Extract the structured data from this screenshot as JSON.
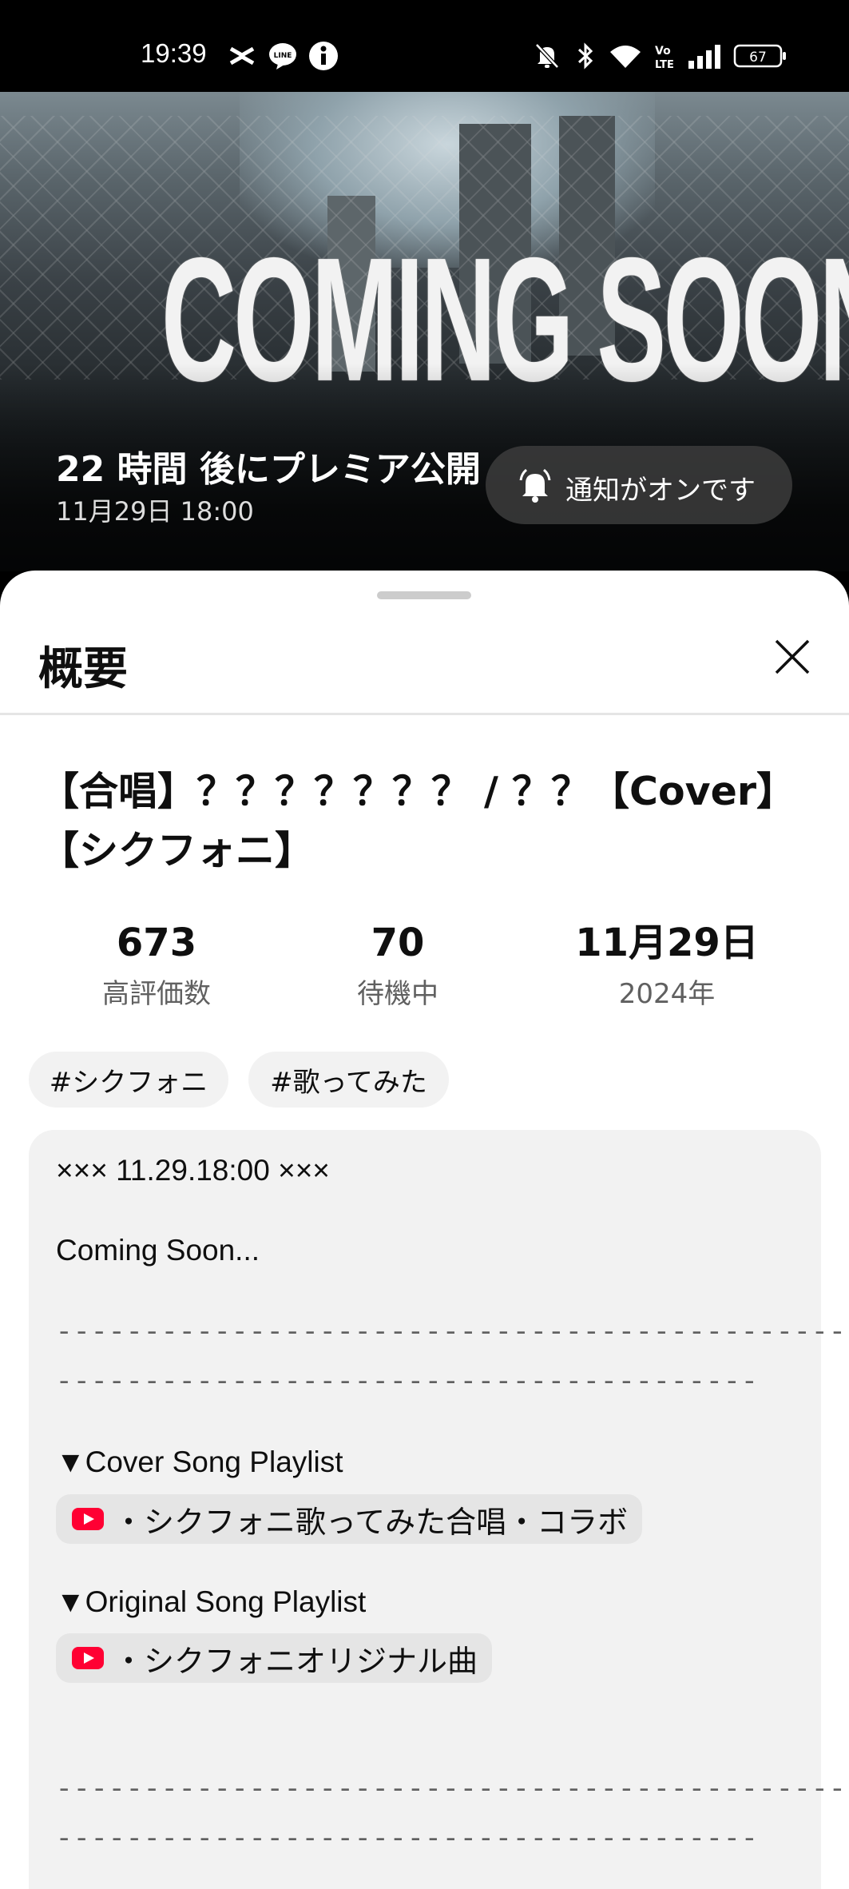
{
  "status_bar": {
    "time": "19:39",
    "battery": "67",
    "icons": [
      "capcut-icon",
      "line-icon",
      "info-icon",
      "mute-icon",
      "bluetooth-icon",
      "wifi-icon",
      "volte-icon",
      "signal-icon",
      "battery-icon"
    ]
  },
  "video": {
    "overlay_text": "COMING SOON",
    "premiere_title": "22 時間 後にプレミア公開",
    "premiere_date": "11月29日 18:00",
    "notify_label": "通知がオンです"
  },
  "sheet": {
    "title": "概要",
    "video_title": "【合唱】？？？？？？？ / ？？【Cover】【シクフォニ】",
    "stats": [
      {
        "value": "673",
        "label": "高評価数"
      },
      {
        "value": "70",
        "label": "待機中"
      },
      {
        "value": "11月29日",
        "label": "2024年"
      }
    ],
    "tags": [
      "#シクフォニ",
      "#歌ってみた"
    ],
    "description": {
      "line1": "××× 11.29.18:00 ×××",
      "line2": "Coming Soon...",
      "separator1": "------------------------------------------------------------",
      "separator2": "----------------------------------------",
      "cover_heading": "▼Cover Song Playlist",
      "cover_link": "・シクフォニ歌ってみた合唱・コラボ",
      "original_heading": "▼Original Song Playlist",
      "original_link": "・シクフォニオリジナル曲",
      "separator3": "------------------------------------------------------------",
      "separator4": "----------------------------------------"
    }
  },
  "colors": {
    "youtube_red": "#ff0033",
    "sheet_bg": "#ffffff",
    "chip_bg": "#f2f2f2"
  }
}
